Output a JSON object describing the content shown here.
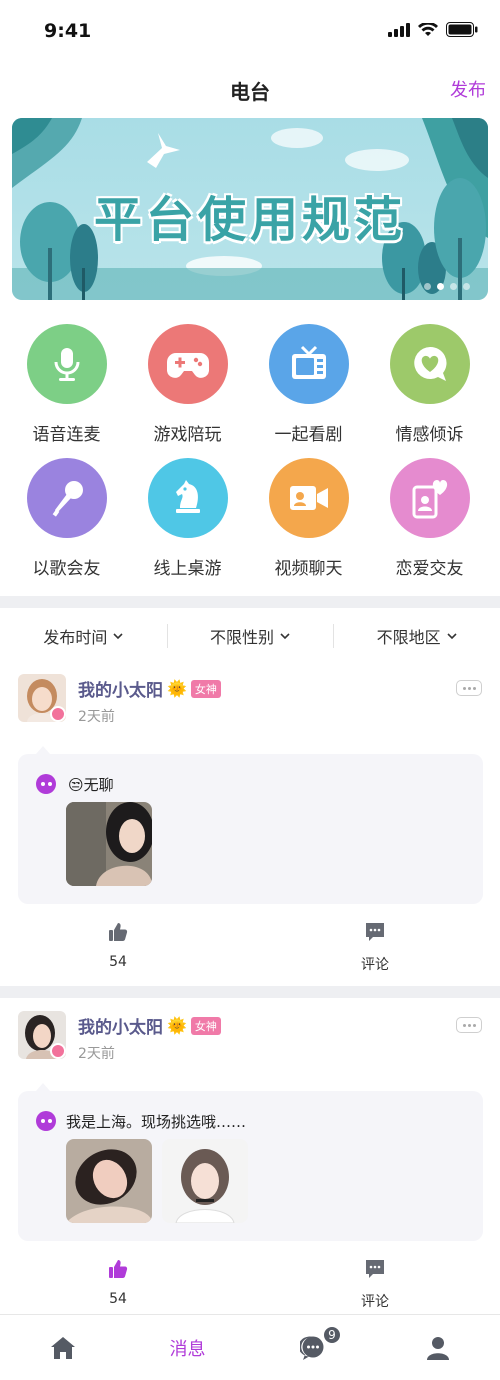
{
  "status_bar": {
    "time": "9:41"
  },
  "header": {
    "title": "电台",
    "publish_label": "发布"
  },
  "banner": {
    "title": "平台使用规范",
    "dot_count": 4,
    "active_dot": 1
  },
  "categories": [
    {
      "label": "语音连麦",
      "icon": "microphone-icon",
      "color": "#7dcf86"
    },
    {
      "label": "游戏陪玩",
      "icon": "gamepad-icon",
      "color": "#ec7877"
    },
    {
      "label": "一起看剧",
      "icon": "tv-icon",
      "color": "#5aa5e8"
    },
    {
      "label": "情感倾诉",
      "icon": "heart-chat-icon",
      "color": "#9dc96a"
    },
    {
      "label": "以歌会友",
      "icon": "karaoke-mic-icon",
      "color": "#9a83df"
    },
    {
      "label": "线上桌游",
      "icon": "chess-knight-icon",
      "color": "#4fc7e6"
    },
    {
      "label": "视频聊天",
      "icon": "video-camera-icon",
      "color": "#f4a74c"
    },
    {
      "label": "恋爱交友",
      "icon": "love-card-icon",
      "color": "#e58bcf"
    }
  ],
  "filters": [
    {
      "label": "发布时间"
    },
    {
      "label": "不限性别"
    },
    {
      "label": "不限地区"
    }
  ],
  "posts": [
    {
      "name": "我的小太阳",
      "badge": "女神",
      "time": "2天前",
      "text": "😒无聊",
      "likes": "54",
      "liked": false,
      "comment_label": "评论",
      "images": [
        "photo-girl-blackhair"
      ]
    },
    {
      "name": "我的小太阳",
      "badge": "女神",
      "time": "2天前",
      "text": "我是上海。现场挑选哦……",
      "likes": "54",
      "liked": true,
      "comment_label": "评论",
      "images": [
        "photo-girl-lying",
        "photo-girl-bob"
      ]
    }
  ],
  "tab_bar": {
    "tabs": [
      {
        "name": "home",
        "icon": "home-icon"
      },
      {
        "name": "messages",
        "label": "消息"
      },
      {
        "name": "chat",
        "icon": "chat-bubble-icon",
        "badge": "9"
      },
      {
        "name": "profile",
        "icon": "person-icon"
      }
    ]
  },
  "colors": {
    "accent": "#b03bd9",
    "goddess_badge": "#f07aa8",
    "liked": "#b03bd9",
    "unliked": "#666a73"
  }
}
